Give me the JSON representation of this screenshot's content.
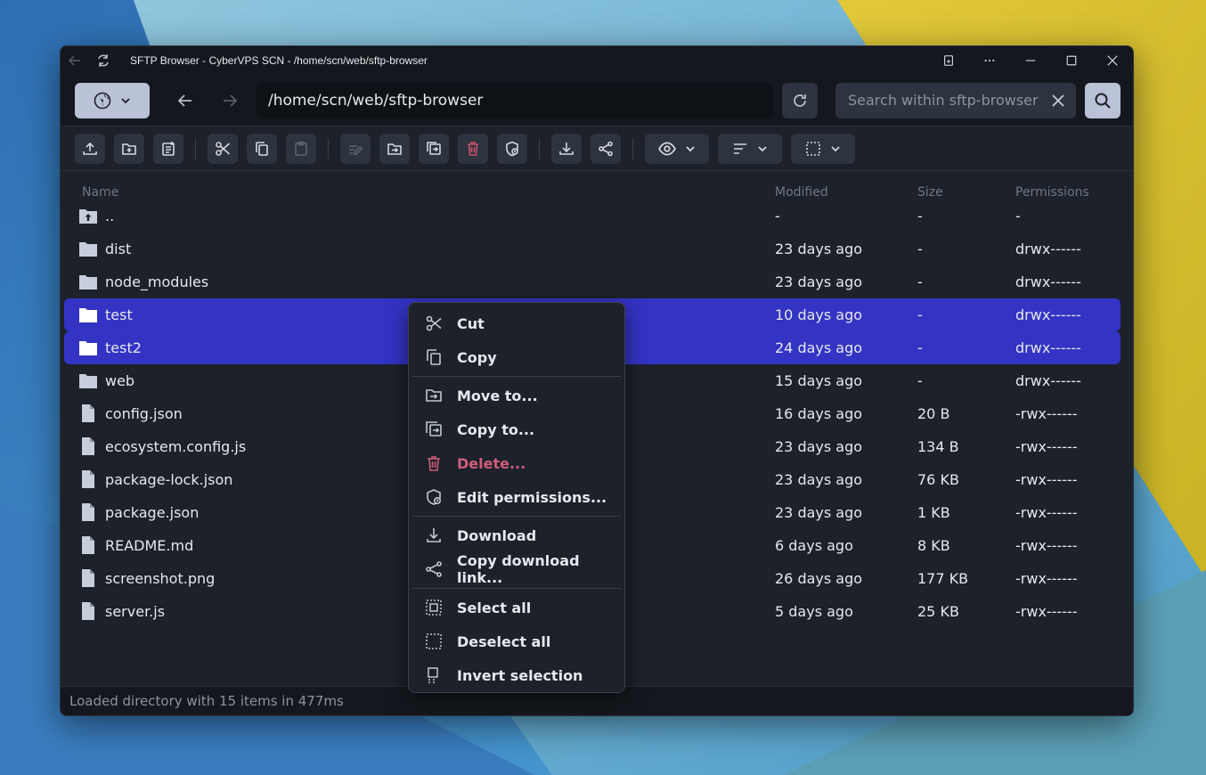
{
  "window": {
    "title": "SFTP Browser - CyberVPS SCN - /home/scn/web/sftp-browser"
  },
  "nav": {
    "path": "/home/scn/web/sftp-browser",
    "search_placeholder": "Search within sftp-browser"
  },
  "columns": {
    "name": "Name",
    "modified": "Modified",
    "size": "Size",
    "permissions": "Permissions"
  },
  "files": [
    {
      "name": "..",
      "type": "parent",
      "modified": "-",
      "size": "-",
      "permissions": "-",
      "selected": false
    },
    {
      "name": "dist",
      "type": "folder",
      "modified": "23 days ago",
      "size": "-",
      "permissions": "drwx------",
      "selected": false
    },
    {
      "name": "node_modules",
      "type": "folder",
      "modified": "23 days ago",
      "size": "-",
      "permissions": "drwx------",
      "selected": false
    },
    {
      "name": "test",
      "type": "folder",
      "modified": "10 days ago",
      "size": "-",
      "permissions": "drwx------",
      "selected": true
    },
    {
      "name": "test2",
      "type": "folder",
      "modified": "24 days ago",
      "size": "-",
      "permissions": "drwx------",
      "selected": true
    },
    {
      "name": "web",
      "type": "folder",
      "modified": "15 days ago",
      "size": "-",
      "permissions": "drwx------",
      "selected": false
    },
    {
      "name": "config.json",
      "type": "file",
      "modified": "16 days ago",
      "size": "20 B",
      "permissions": "-rwx------",
      "selected": false
    },
    {
      "name": "ecosystem.config.js",
      "type": "file",
      "modified": "23 days ago",
      "size": "134 B",
      "permissions": "-rwx------",
      "selected": false
    },
    {
      "name": "package-lock.json",
      "type": "file",
      "modified": "23 days ago",
      "size": "76 KB",
      "permissions": "-rwx------",
      "selected": false
    },
    {
      "name": "package.json",
      "type": "file",
      "modified": "23 days ago",
      "size": "1 KB",
      "permissions": "-rwx------",
      "selected": false
    },
    {
      "name": "README.md",
      "type": "file",
      "modified": "6 days ago",
      "size": "8 KB",
      "permissions": "-rwx------",
      "selected": false
    },
    {
      "name": "screenshot.png",
      "type": "file",
      "modified": "26 days ago",
      "size": "177 KB",
      "permissions": "-rwx------",
      "selected": false
    },
    {
      "name": "server.js",
      "type": "file",
      "modified": "5 days ago",
      "size": "25 KB",
      "permissions": "-rwx------",
      "selected": false
    }
  ],
  "context_menu": {
    "cut": "Cut",
    "copy": "Copy",
    "move_to": "Move to...",
    "copy_to": "Copy to...",
    "delete": "Delete...",
    "edit_permissions": "Edit permissions...",
    "download": "Download",
    "copy_download_link": "Copy download link...",
    "select_all": "Select all",
    "deselect_all": "Deselect all",
    "invert_selection": "Invert selection"
  },
  "status": {
    "text": "Loaded directory with 15 items in 477ms"
  },
  "colors": {
    "selection": "#3333c4",
    "danger": "#d05d7a",
    "accent_button": "#b9c2d6"
  }
}
